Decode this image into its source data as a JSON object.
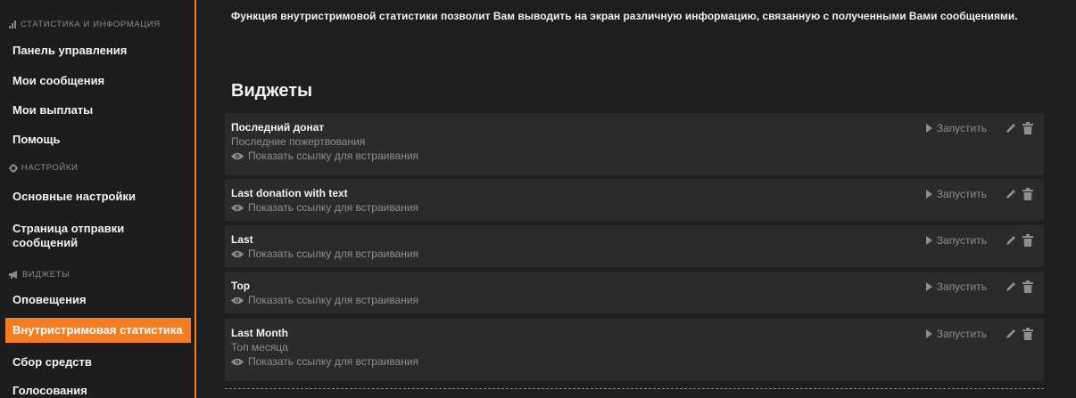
{
  "sidebar": {
    "sections": [
      {
        "label": "СТАТИСТИКА И ИНФОРМАЦИЯ",
        "icon": "bar-chart-icon"
      },
      {
        "label": "НАСТРОЙКИ",
        "icon": "gear-icon"
      },
      {
        "label": "ВИДЖЕТЫ",
        "icon": "megaphone-icon"
      }
    ],
    "items": [
      "Панель управления",
      "Мои сообщения",
      "Мои выплаты",
      "Помощь",
      "Основные настройки",
      "Страница отправки сообщений",
      "Оповещения",
      "Внутристримовая статистика",
      "Сбор средств",
      "Голосования"
    ],
    "active_item": "Внутристримовая статистика"
  },
  "main": {
    "intro": "Функция внутристримовой статистики позволит Вам выводить на экран различную информацию, связанную с полученными Вами сообщениями.",
    "title": "Виджеты",
    "run_label": "Запустить",
    "embed_link_label": "Показать ссылку для встраивания",
    "widgets": [
      {
        "name": "Последний донат",
        "subtitle": "Последние пожертвования"
      },
      {
        "name": "Last donation with text"
      },
      {
        "name": "Last"
      },
      {
        "name": "Top"
      },
      {
        "name": "Last Month",
        "subtitle": "Топ месяца"
      }
    ]
  },
  "colors": {
    "accent": "#f57d20",
    "panel": "#2b2b2b",
    "background": "#1e1e1e",
    "muted": "#8e8e8e"
  }
}
